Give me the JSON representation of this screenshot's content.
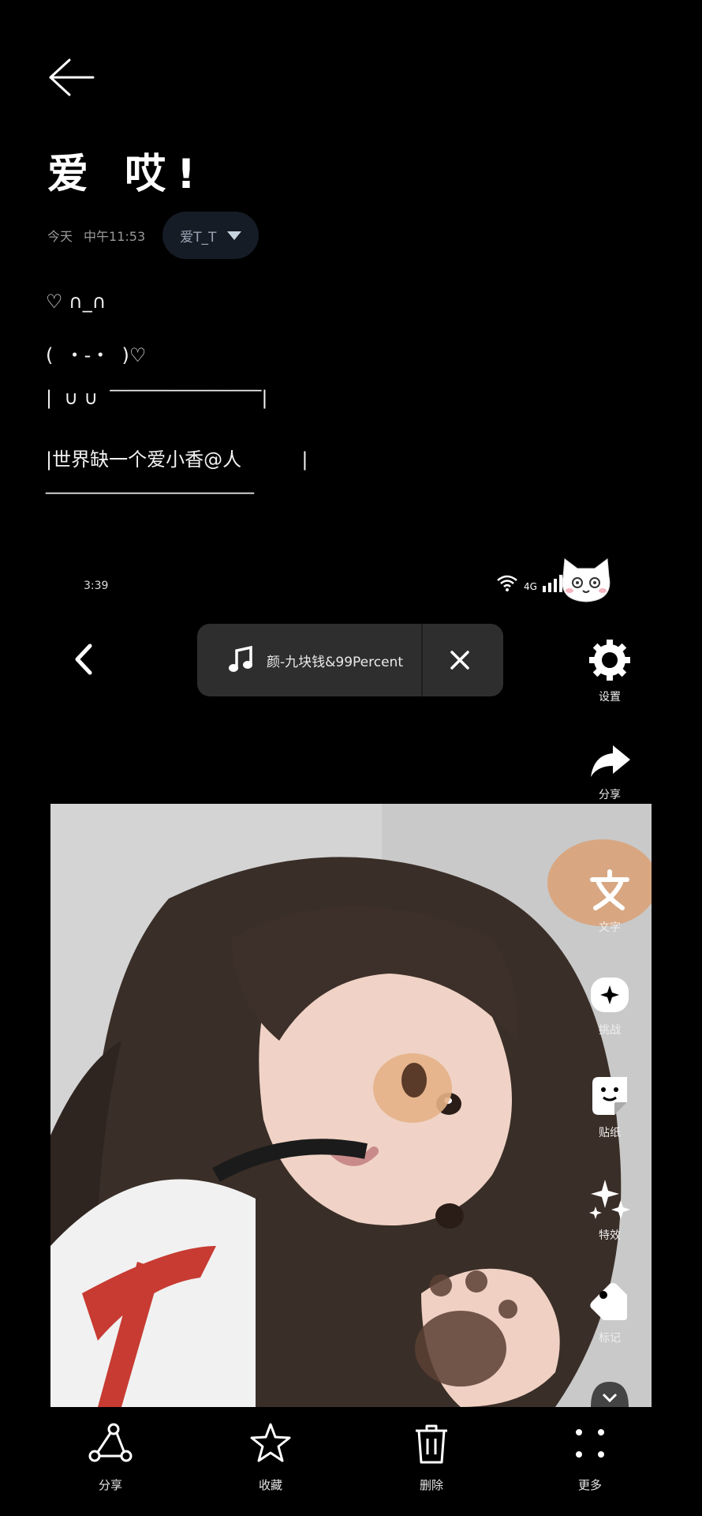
{
  "note": {
    "title": "爱 哎!",
    "date": "今天",
    "time": "中午11:53",
    "tag": "爱T_T",
    "lines": [
      "♡ ∩_∩",
      "(  ・-・  )♡",
      "|  ∪ ∪  ‾‾‾‾‾‾‾‾‾‾‾‾‾‾‾‾|",
      "|世界缺一个爱小香@人          |",
      "‾‾‾‾‾‾‾‾‾‾‾‾‾‾‾‾‾‾‾‾‾‾"
    ]
  },
  "screenshot": {
    "status_time": "3:39",
    "signal_text": "4G",
    "music_title": "颜-九块钱&99Percent"
  },
  "rail": {
    "settings": "设置",
    "share": "分享",
    "text": "文字",
    "challenge": "挑战",
    "sticker": "贴纸",
    "effects": "特效",
    "tag": "标记"
  },
  "bottom": {
    "share": "分享",
    "favorite": "收藏",
    "delete": "删除",
    "more": "更多"
  },
  "colors": {
    "background": "#000000",
    "pill": "#151c26",
    "music_bar": "#2e2e2e"
  }
}
